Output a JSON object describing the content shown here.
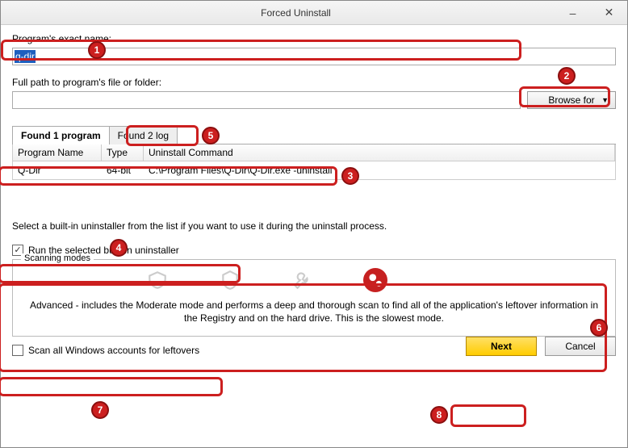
{
  "window": {
    "title": "Forced Uninstall",
    "minimize": "–",
    "close": "✕"
  },
  "labels": {
    "exact_name": "Program's exact name:",
    "full_path": "Full path to program's file or folder:"
  },
  "inputs": {
    "program_name": "q-dir",
    "full_path": ""
  },
  "buttons": {
    "browse": "Browse for",
    "next": "Next",
    "cancel": "Cancel"
  },
  "tabs": {
    "found_program": "Found 1 program",
    "found_log": "Found 2 log"
  },
  "grid": {
    "headers": {
      "name": "Program Name",
      "type": "Type",
      "cmd": "Uninstall Command"
    },
    "row": {
      "name": "Q-Dir",
      "type": "64-bit",
      "cmd": "C:\\Program Files\\Q-Dir\\Q-Dir.exe -uninstall"
    }
  },
  "instruction": "Select a built-in uninstaller from the list if you want to use it during the uninstall process.",
  "checks": {
    "run_builtin": "Run the selected built-in uninstaller",
    "scan_all": "Scan all Windows accounts for leftovers"
  },
  "modes": {
    "legend": "Scanning modes",
    "desc": "Advanced - includes the Moderate mode and performs a deep and thorough scan to find all of the application's leftover information in the Registry and on the hard drive. This is the slowest mode."
  },
  "annotations": {
    "n1": "1",
    "n2": "2",
    "n3": "3",
    "n4": "4",
    "n5": "5",
    "n6": "6",
    "n7": "7",
    "n8": "8"
  }
}
